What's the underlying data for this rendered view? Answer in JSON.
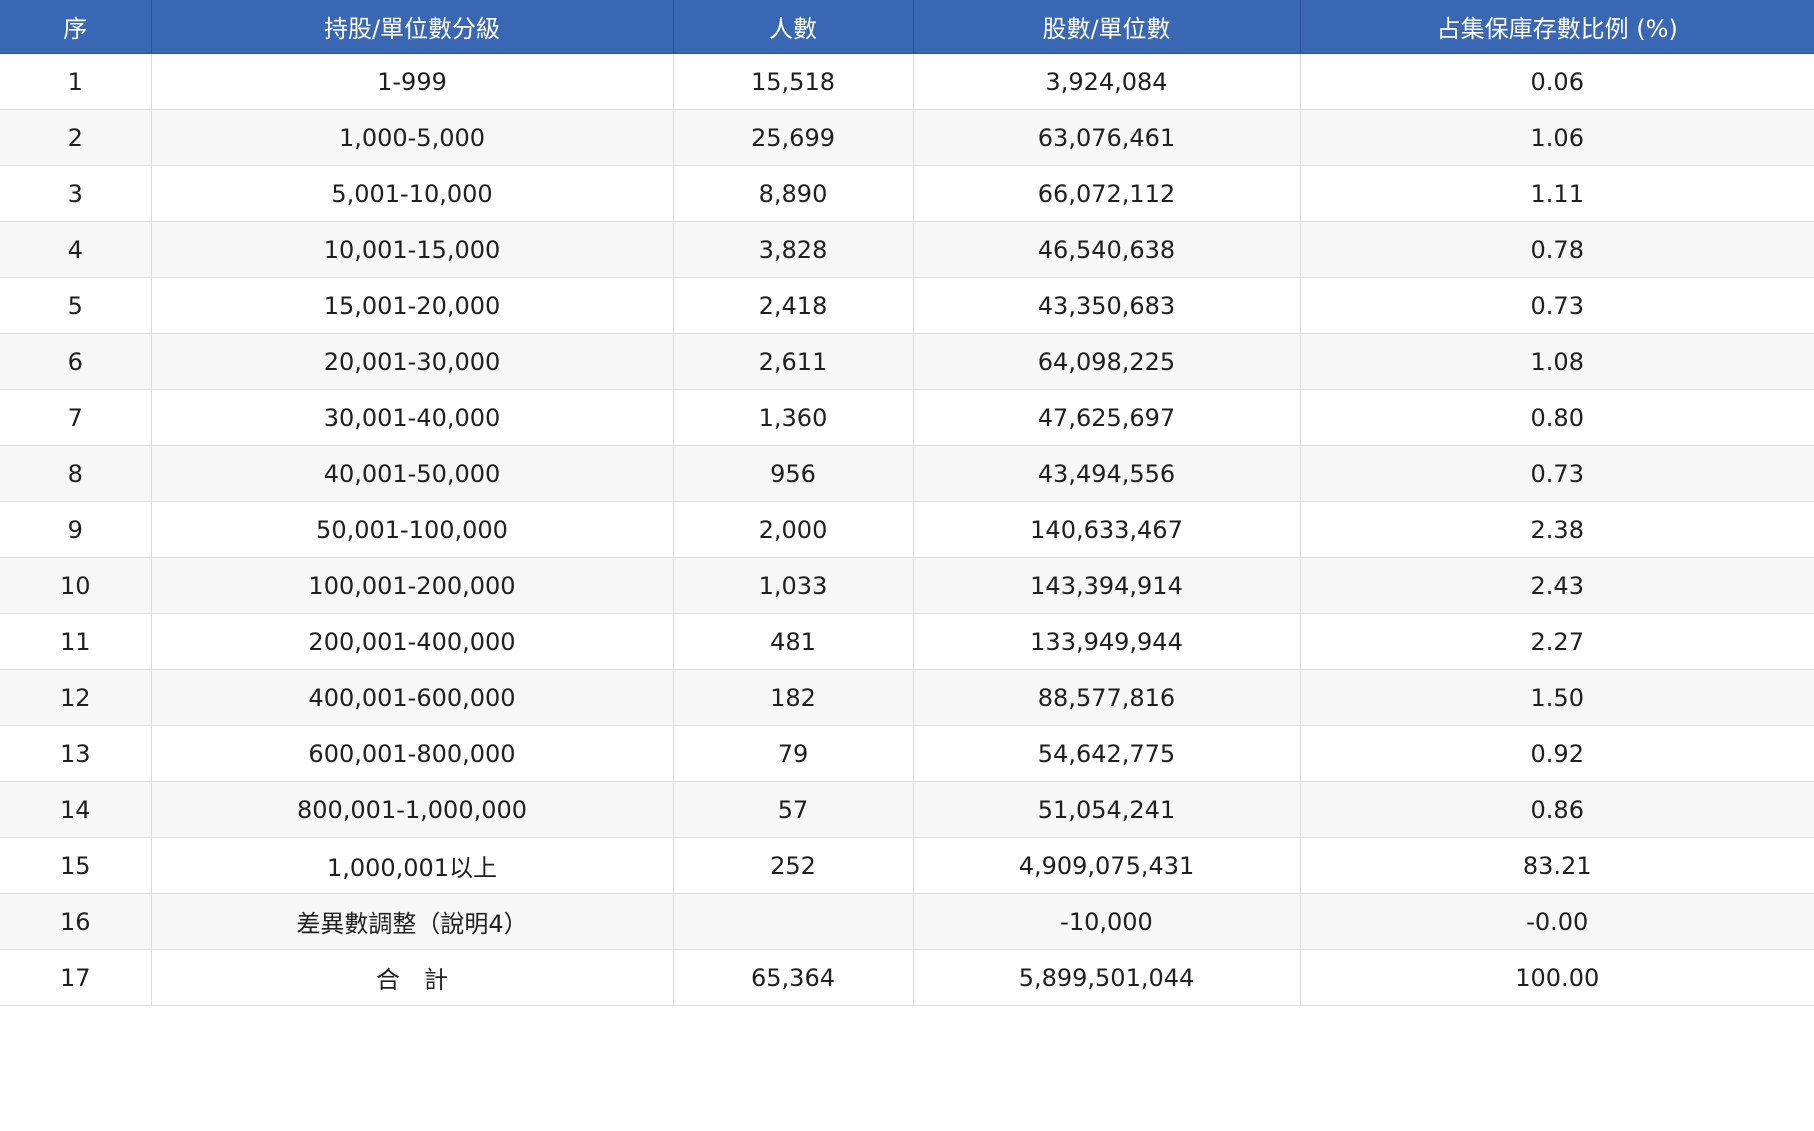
{
  "table": {
    "headers": [
      "序",
      "持股/單位數分級",
      "人數",
      "股數/單位數",
      "占集保庫存數比例 (%)"
    ],
    "rows": [
      [
        "1",
        "1-999",
        "15,518",
        "3,924,084",
        "0.06"
      ],
      [
        "2",
        "1,000-5,000",
        "25,699",
        "63,076,461",
        "1.06"
      ],
      [
        "3",
        "5,001-10,000",
        "8,890",
        "66,072,112",
        "1.11"
      ],
      [
        "4",
        "10,001-15,000",
        "3,828",
        "46,540,638",
        "0.78"
      ],
      [
        "5",
        "15,001-20,000",
        "2,418",
        "43,350,683",
        "0.73"
      ],
      [
        "6",
        "20,001-30,000",
        "2,611",
        "64,098,225",
        "1.08"
      ],
      [
        "7",
        "30,001-40,000",
        "1,360",
        "47,625,697",
        "0.80"
      ],
      [
        "8",
        "40,001-50,000",
        "956",
        "43,494,556",
        "0.73"
      ],
      [
        "9",
        "50,001-100,000",
        "2,000",
        "140,633,467",
        "2.38"
      ],
      [
        "10",
        "100,001-200,000",
        "1,033",
        "143,394,914",
        "2.43"
      ],
      [
        "11",
        "200,001-400,000",
        "481",
        "133,949,944",
        "2.27"
      ],
      [
        "12",
        "400,001-600,000",
        "182",
        "88,577,816",
        "1.50"
      ],
      [
        "13",
        "600,001-800,000",
        "79",
        "54,642,775",
        "0.92"
      ],
      [
        "14",
        "800,001-1,000,000",
        "57",
        "51,054,241",
        "0.86"
      ],
      [
        "15",
        "1,000,001以上",
        "252",
        "4,909,075,431",
        "83.21"
      ],
      [
        "16",
        "差異數調整（說明4）",
        "",
        "-10,000",
        "-0.00"
      ],
      [
        "17",
        "合　計",
        "65,364",
        "5,899,501,044",
        "100.00"
      ]
    ]
  }
}
